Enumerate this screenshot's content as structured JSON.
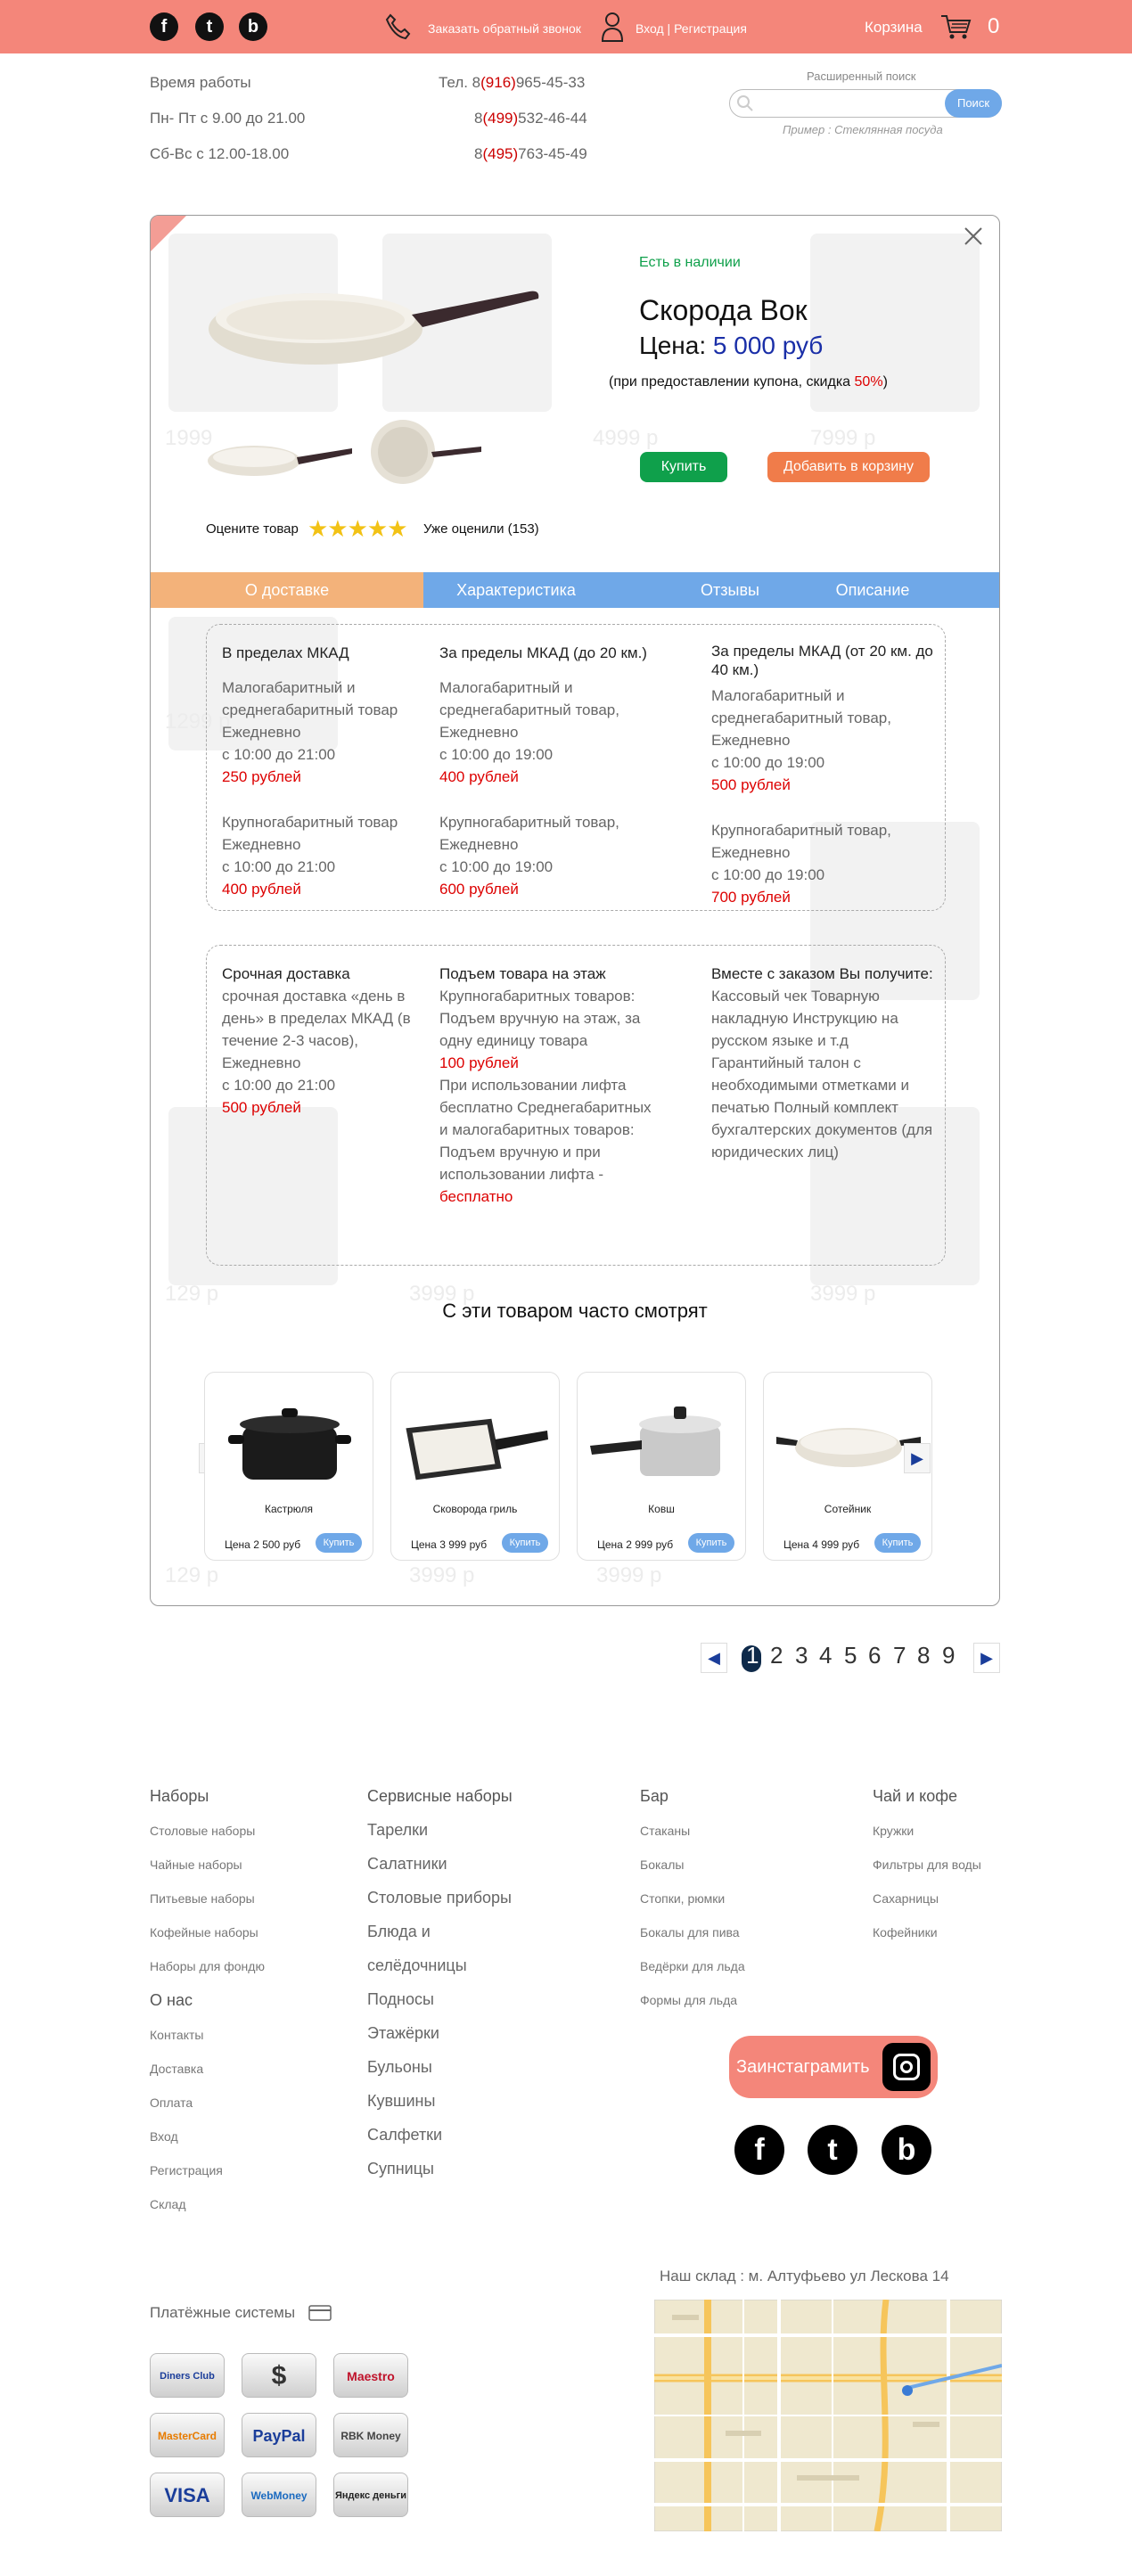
{
  "header": {
    "social": [
      "f",
      "t",
      "b"
    ],
    "callback": "Заказать обратный звонок",
    "auth": "Вход | Регистрация",
    "cart_label": "Корзина",
    "cart_count": "0"
  },
  "info": {
    "hours_title": "Время работы",
    "weekday": "Пн- Пт с 9.00 до 21.00",
    "weekend": "Сб-Вс с 12.00-18.00",
    "phone_label": "Тел. 8",
    "phones": [
      {
        "code": "(916)",
        "num": "965-45-33"
      },
      {
        "code": "(499)",
        "num": "532-46-44"
      },
      {
        "code": "(495)",
        "num": "763-45-49"
      }
    ],
    "phone_prefix": "8"
  },
  "search": {
    "advanced": "Расширенный поиск",
    "placeholder": "",
    "button": "Поиск",
    "example": "Пример : Стеклянная посуда"
  },
  "modal": {
    "stock": "Есть в наличии",
    "title": "Скорода Вок",
    "price_label": "Цена: ",
    "price": "5 000 руб",
    "coupon_pre": "(при предоставлении купона, скидка ",
    "coupon_pct": "50%",
    "coupon_post": ")",
    "buy": "Купить",
    "add_cart": "Добавить в корзину",
    "rate": "Оцените товар",
    "rated": "Уже оценили (153)",
    "stars": 5,
    "tabs": [
      "О доставке",
      "Характеристика",
      "Отзывы",
      "Описание"
    ],
    "delivery": {
      "c1": {
        "h": "В пределах МКАД",
        "s1": "Малогабаритный и среднегабаритный товар Ежедневно",
        "t1": "с 10:00 до 21:00",
        "p1": "250 рублей",
        "s2": "Крупногабаритный товар Ежедневно",
        "t2": " с 10:00 до 21:00",
        "p2": "400 рублей"
      },
      "c2": {
        "h": "За пределы МКАД (до 20 км.)",
        "s1": "Малогабаритный и среднегабаритный товар, Ежедневно",
        "t1": " с 10:00 до 19:00",
        "p1": "400 рублей",
        "s2": "Крупногабаритный товар, Ежедневно",
        "t2": " с 10:00 до 19:00",
        "p2": " 600 рублей"
      },
      "c3": {
        "h": "За пределы МКАД (от 20 км. до 40 км.)",
        "s1": "Малогабаритный и среднегабаритный товар, Ежедневно",
        "t1": "с 10:00 до 19:00",
        "p1": "500 рублей",
        "s2": "Крупногабаритный товар, Ежедневно",
        "t2": " с 10:00 до 19:00",
        "p2": "700 рублей"
      }
    },
    "extra": {
      "c1": {
        "h": "Срочная доставка",
        "t": "срочная доставка «день в день» в пределах МКАД (в течение 2-3 часов), Ежедневно",
        "t2": " с 10:00 до 21:00",
        "p": "500 рублей"
      },
      "c2": {
        "h": "Подъем товара на этаж",
        "t": "Крупногабаритных товаров: Подъем вручную на этаж, за одну единицу товара",
        "p": "100 рублей",
        "t2": "При использовании лифта бесплатно Среднегабаритных и малогабаритных товаров: Подъем вручную и при использовании лифта -",
        "p2": "бесплатно"
      },
      "c3": {
        "h": "Вместе с заказом Вы получите:",
        "t": "Кассовый чек Товарную накладную Инструкцию на русском языке и т.д Гарантийный талон с необходимыми отметками и печатью Полный комплект бухгалтерских документов (для юридических лиц)"
      }
    },
    "related_title": "С эти товаром часто смотрят",
    "related": [
      {
        "name": "Кастрюля",
        "price_label": "Цена",
        "price": "2 500 руб",
        "buy": "Купить"
      },
      {
        "name": "Сковорода гриль",
        "price_label": "Цена",
        "price": "3 999 руб",
        "buy": "Купить"
      },
      {
        "name": "Ковш",
        "price_label": "Цена",
        "price": "2 999 руб",
        "buy": "Купить"
      },
      {
        "name": "Сотейник",
        "price_label": "Цена",
        "price": "4 999 руб",
        "buy": "Купить"
      }
    ],
    "bg_prices": [
      "1999",
      "4999 р",
      "7999 р",
      "1299 р",
      "129 р",
      "3999 р",
      "3999 р",
      "129 р",
      "3999 р",
      "3999 р"
    ]
  },
  "pagination": [
    "1",
    "2",
    "3",
    "4",
    "5",
    "6",
    "7",
    "8",
    "9"
  ],
  "footer": {
    "col1": {
      "h": "Наборы",
      "items": [
        "Столовые наборы",
        "Чайные наборы",
        "Питьевые наборы",
        "Кофейные наборы",
        "Наборы для фондю"
      ],
      "h2": "О нас",
      "items2": [
        "Контакты",
        "Доставка",
        "Оплата",
        "Вход",
        "Регистрация",
        "Склад"
      ]
    },
    "col2": {
      "h": "Сервисные наборы",
      "items": [
        "Тарелки",
        "Салатники",
        "Столовые приборы",
        "Блюда и",
        "селёдочницы",
        "Подносы",
        "Этажёрки",
        "Бульоны",
        "Кувшины",
        "Салфетки",
        "Супницы"
      ]
    },
    "col3": {
      "h": "Бар",
      "items": [
        "Стаканы",
        "Бокалы",
        "Стопки, рюмки",
        "Бокалы для пива",
        "Ведёрки для льда",
        "Формы для льда"
      ]
    },
    "col4": {
      "h": "Чай и кофе",
      "items": [
        "Кружки",
        "Фильтры для воды",
        "Сахарницы",
        "Кофейники"
      ]
    },
    "instagram": "Заинстаграмить",
    "payments_title": "Платёжные системы",
    "payments": [
      "Diners Club",
      "$",
      "Maestro",
      "MasterCard",
      "PayPal",
      "RBK Money",
      "VISA",
      "WebMoney",
      "Яндекс деньги"
    ],
    "warehouse": "Наш склад : м. Алтуфьево ул Лескова 14"
  },
  "colors": {
    "header": "#f4867a",
    "accent": "#6fa8e8",
    "buy": "#0fa04b",
    "cart": "#f07c4a"
  }
}
